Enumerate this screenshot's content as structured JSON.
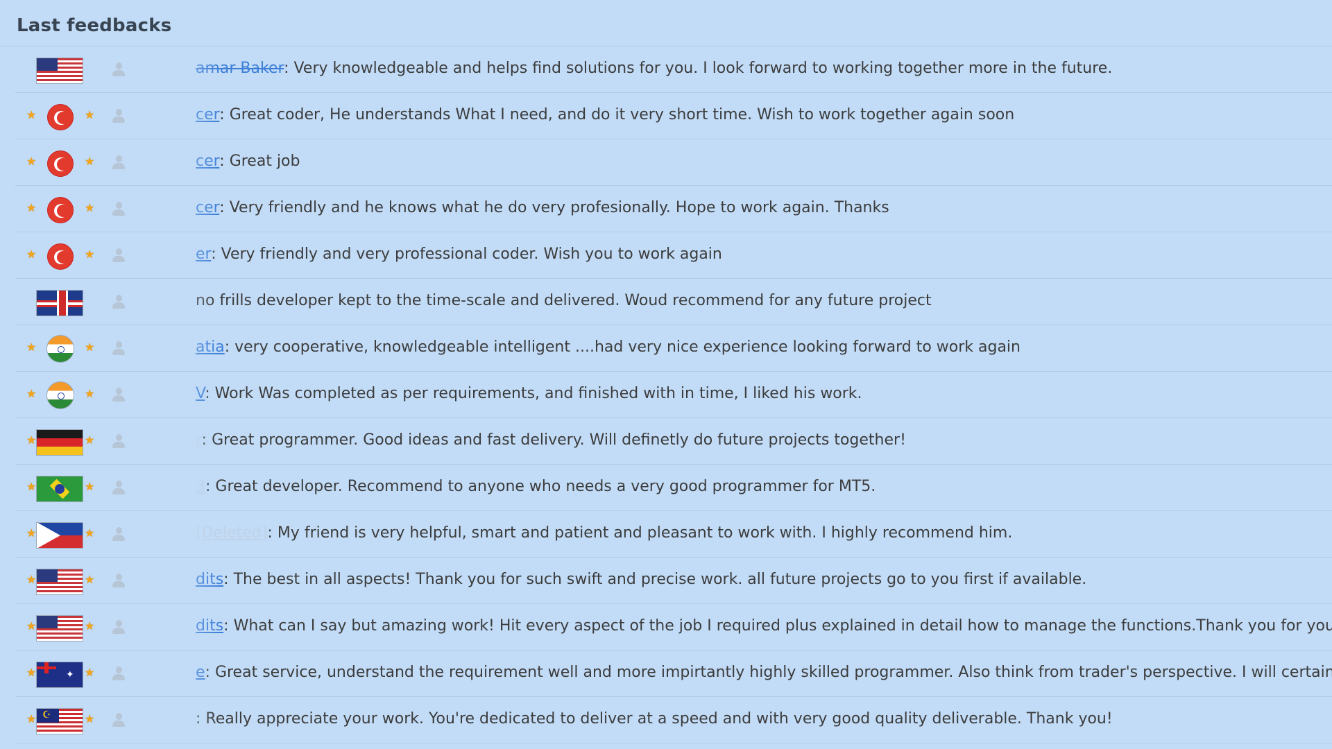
{
  "title": "Last feedbacks",
  "colors": {
    "background": "#c2dcf7",
    "link": "#3d7ed8",
    "star": "#f2a51c",
    "divider": "#aecbe7"
  },
  "feedbacks": [
    {
      "flag": "us-flag",
      "stars": false,
      "author": "amar Baker",
      "author_style": "strike",
      "text": ": Very knowledgeable and helps find solutions for you. I look forward to working together more in the future."
    },
    {
      "flag": "turkey-flag",
      "stars": true,
      "author": "cer",
      "author_style": "link",
      "text": ": Great coder, He understands What I need, and do it very short time. Wish to work together again soon"
    },
    {
      "flag": "turkey-flag",
      "stars": true,
      "author": "cer",
      "author_style": "link",
      "text": ": Great job"
    },
    {
      "flag": "turkey-flag",
      "stars": true,
      "author": "cer",
      "author_style": "link",
      "text": ": Very friendly and he knows what he do very profesionally. Hope to work again. Thanks"
    },
    {
      "flag": "turkey-flag",
      "stars": true,
      "author": "er",
      "author_style": "link",
      "text": ": Very friendly and very professional coder. Wish you to work again"
    },
    {
      "flag": "uk-flag",
      "stars": false,
      "author": "",
      "author_style": "link",
      "text": "no frills developer kept to the time-scale and delivered. Woud recommend for any future project"
    },
    {
      "flag": "india-flag",
      "stars": true,
      "author": "atia",
      "author_style": "link",
      "text": ": very cooperative, knowledgeable intelligent ....had very nice experience looking forward to work again"
    },
    {
      "flag": "india-flag",
      "stars": true,
      "author": "V",
      "author_style": "link",
      "text": ": Work Was completed as per requirements, and finished with in time, I liked his work."
    },
    {
      "flag": "germany-flag",
      "stars": true,
      "author": "r",
      "author_style": "faded",
      "text": ": Great programmer. Good ideas and fast delivery. Will definetly do future projects together!"
    },
    {
      "flag": "brazil-flag",
      "stars": true,
      "author": "3",
      "author_style": "faded",
      "text": ": Great developer. Recommend to anyone who needs a very good programmer for MT5."
    },
    {
      "flag": "philippines-flag",
      "stars": true,
      "author": "[Deleted]",
      "author_style": "faded",
      "text": ": My friend is very helpful, smart and patient and pleasant to work with. I highly recommend him."
    },
    {
      "flag": "us-flag",
      "stars": true,
      "author": "dits",
      "author_style": "link",
      "text": ": The best in all aspects! Thank you for such swift and precise work. all future projects go to you first if available."
    },
    {
      "flag": "us-flag",
      "stars": true,
      "author": "dits",
      "author_style": "link",
      "text": ": What can I say but amazing work! Hit every aspect of the job I required plus explained in detail how to manage the functions.Thank you for your out"
    },
    {
      "flag": "australia-flag",
      "stars": true,
      "author": "e",
      "author_style": "link",
      "text": ": Great service, understand the requirement well and more impirtantly highly skilled programmer. Also think from trader's perspective. I will certainly h"
    },
    {
      "flag": "malaysia-flag",
      "stars": true,
      "author": "",
      "author_style": "link",
      "text": ": Really appreciate your work. You're dedicated to deliver at a speed and with very good quality deliverable. Thank you!"
    }
  ]
}
